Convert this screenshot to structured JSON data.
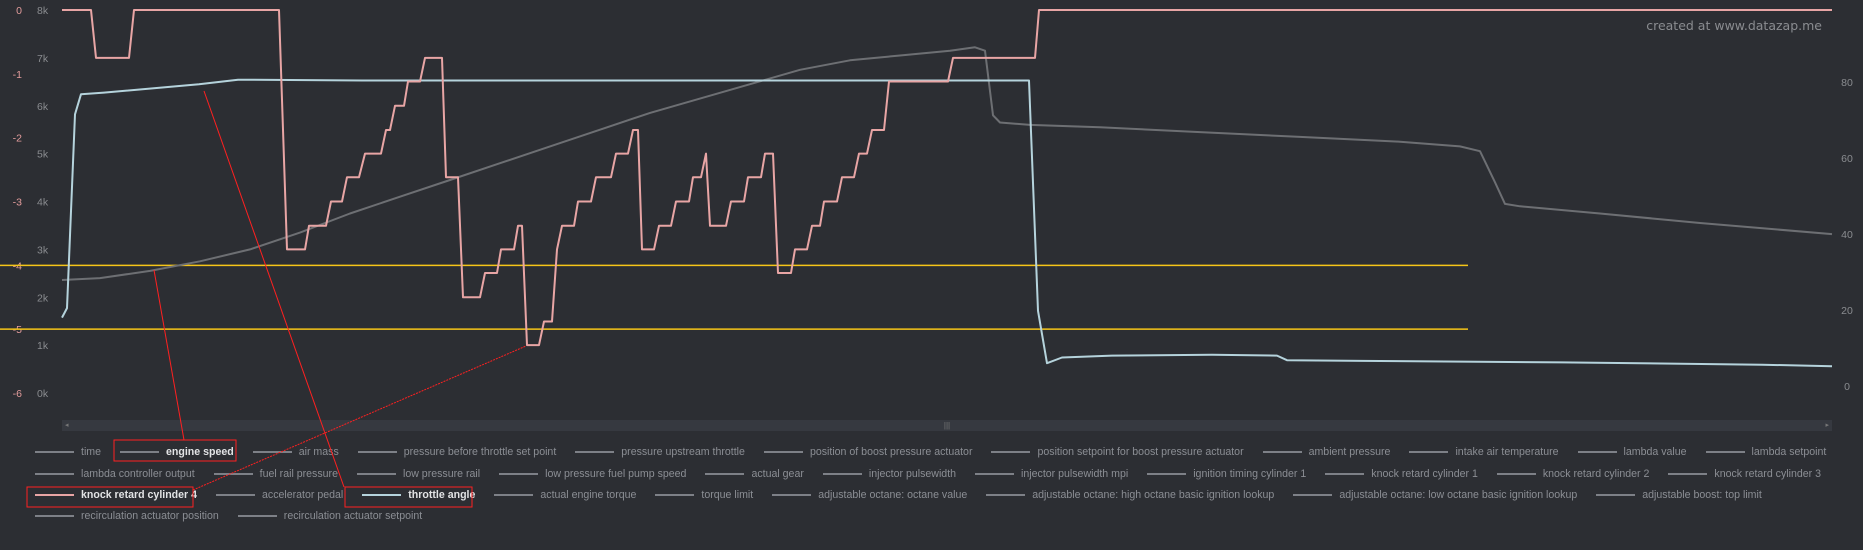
{
  "watermark": "created at www.datazap.me",
  "colors": {
    "background": "#2c2e33",
    "knock": "#e8a5a5",
    "throttle": "#b5d3dc",
    "engine_speed": "#6d6f73",
    "reference": "#f5c518",
    "annotation": "#ff2020",
    "knock_axis": "#e39c9c",
    "axis_text": "#8a8c90"
  },
  "chart_data": {
    "type": "line",
    "axes": {
      "knock": {
        "ticks": [
          "0",
          "-1",
          "-2",
          "-3",
          "-4",
          "-5",
          "-6"
        ],
        "range": [
          -6,
          0
        ]
      },
      "rpm": {
        "ticks": [
          "8k",
          "7k",
          "6k",
          "5k",
          "4k",
          "3k",
          "2k",
          "1k",
          "0k"
        ],
        "range": [
          0,
          8000
        ]
      },
      "right": {
        "ticks": [
          "80",
          "60",
          "40",
          "20",
          "0"
        ],
        "range": [
          -1.8,
          99
        ]
      },
      "x": {
        "range": [
          0,
          1770
        ],
        "labels": []
      }
    },
    "grid": false,
    "reference_lines": [
      {
        "axis": "knock",
        "value": -4
      },
      {
        "axis": "knock",
        "value": -5
      }
    ],
    "series": [
      {
        "name": "engine speed",
        "axis": "rpm",
        "color": "#6d6f73",
        "points": [
          [
            0,
            2360
          ],
          [
            38,
            2400
          ],
          [
            88,
            2550
          ],
          [
            138,
            2750
          ],
          [
            188,
            3000
          ],
          [
            238,
            3350
          ],
          [
            288,
            3750
          ],
          [
            338,
            4100
          ],
          [
            388,
            4450
          ],
          [
            438,
            4800
          ],
          [
            488,
            5150
          ],
          [
            538,
            5500
          ],
          [
            588,
            5850
          ],
          [
            638,
            6150
          ],
          [
            688,
            6450
          ],
          [
            738,
            6750
          ],
          [
            788,
            6950
          ],
          [
            838,
            7050
          ],
          [
            888,
            7150
          ],
          [
            913,
            7220
          ],
          [
            923,
            7150
          ],
          [
            931,
            5800
          ],
          [
            938,
            5650
          ],
          [
            968,
            5600
          ],
          [
            1038,
            5550
          ],
          [
            1138,
            5450
          ],
          [
            1238,
            5350
          ],
          [
            1338,
            5250
          ],
          [
            1398,
            5150
          ],
          [
            1418,
            5050
          ],
          [
            1433,
            4400
          ],
          [
            1443,
            3950
          ],
          [
            1458,
            3900
          ],
          [
            1538,
            3750
          ],
          [
            1638,
            3550
          ],
          [
            1770,
            3320
          ]
        ]
      },
      {
        "name": "throttle angle",
        "axis": "right",
        "color": "#b5d3dc",
        "points": [
          [
            0,
            18
          ],
          [
            5,
            20.5
          ],
          [
            13,
            71.5
          ],
          [
            19,
            76.8
          ],
          [
            42,
            77.2
          ],
          [
            137,
            79.4
          ],
          [
            176,
            80.6
          ],
          [
            300,
            80.4
          ],
          [
            600,
            80.4
          ],
          [
            967,
            80.4
          ],
          [
            976,
            19.8
          ],
          [
            985,
            6
          ],
          [
            1000,
            7.5
          ],
          [
            1050,
            8
          ],
          [
            1150,
            8.2
          ],
          [
            1215,
            8
          ],
          [
            1225,
            6.8
          ],
          [
            1300,
            6.6
          ],
          [
            1500,
            6.2
          ],
          [
            1700,
            5.6
          ],
          [
            1770,
            5.2
          ]
        ]
      },
      {
        "name": "knock retard cylinder 4",
        "axis": "knock",
        "color": "#e8a5a5",
        "points": [
          [
            0,
            0
          ],
          [
            29,
            0
          ],
          [
            34,
            -0.75
          ],
          [
            67,
            -0.75
          ],
          [
            72,
            0
          ],
          [
            217,
            0
          ],
          [
            225,
            -3.75
          ],
          [
            243,
            -3.75
          ],
          [
            247,
            -3.38
          ],
          [
            264,
            -3.38
          ],
          [
            269,
            -3
          ],
          [
            280,
            -3
          ],
          [
            285,
            -2.62
          ],
          [
            297,
            -2.62
          ],
          [
            303,
            -2.25
          ],
          [
            319,
            -2.25
          ],
          [
            324,
            -1.88
          ],
          [
            328,
            -1.88
          ],
          [
            333,
            -1.5
          ],
          [
            342,
            -1.5
          ],
          [
            346,
            -1.12
          ],
          [
            358,
            -1.12
          ],
          [
            363,
            -0.75
          ],
          [
            380,
            -0.75
          ],
          [
            384,
            -2.62
          ],
          [
            396,
            -2.62
          ],
          [
            401,
            -4.5
          ],
          [
            418,
            -4.5
          ],
          [
            423,
            -4.12
          ],
          [
            435,
            -4.12
          ],
          [
            439,
            -3.75
          ],
          [
            452,
            -3.75
          ],
          [
            456,
            -3.38
          ],
          [
            460,
            -3.38
          ],
          [
            465,
            -5.25
          ],
          [
            477,
            -5.25
          ],
          [
            482,
            -4.88
          ],
          [
            490,
            -4.88
          ],
          [
            495,
            -3.75
          ],
          [
            500,
            -3.38
          ],
          [
            512,
            -3.38
          ],
          [
            516,
            -3
          ],
          [
            529,
            -3
          ],
          [
            534,
            -2.62
          ],
          [
            549,
            -2.62
          ],
          [
            554,
            -2.25
          ],
          [
            566,
            -2.25
          ],
          [
            571,
            -1.88
          ],
          [
            576,
            -1.88
          ],
          [
            580,
            -3.75
          ],
          [
            592,
            -3.75
          ],
          [
            597,
            -3.38
          ],
          [
            609,
            -3.38
          ],
          [
            614,
            -3
          ],
          [
            627,
            -3
          ],
          [
            631,
            -2.62
          ],
          [
            639,
            -2.62
          ],
          [
            644,
            -2.25
          ],
          [
            648,
            -3.38
          ],
          [
            664,
            -3.38
          ],
          [
            669,
            -3
          ],
          [
            682,
            -3
          ],
          [
            686,
            -2.62
          ],
          [
            699,
            -2.62
          ],
          [
            703,
            -2.25
          ],
          [
            711,
            -2.25
          ],
          [
            716,
            -4.12
          ],
          [
            729,
            -4.12
          ],
          [
            733,
            -3.75
          ],
          [
            745,
            -3.75
          ],
          [
            750,
            -3.38
          ],
          [
            758,
            -3.38
          ],
          [
            762,
            -3
          ],
          [
            775,
            -3
          ],
          [
            780,
            -2.62
          ],
          [
            792,
            -2.62
          ],
          [
            797,
            -2.25
          ],
          [
            805,
            -2.25
          ],
          [
            810,
            -1.88
          ],
          [
            822,
            -1.88
          ],
          [
            827,
            -1.12
          ],
          [
            886,
            -1.12
          ],
          [
            891,
            -0.75
          ],
          [
            973,
            -0.75
          ],
          [
            977,
            0
          ],
          [
            1770,
            0
          ]
        ]
      }
    ]
  },
  "legend": {
    "rows": [
      [
        {
          "label": "time"
        },
        {
          "label": "engine speed",
          "highlighted": true
        },
        {
          "label": "air mass"
        },
        {
          "label": "pressure before throttle set point"
        },
        {
          "label": "pressure upstream throttle"
        },
        {
          "label": "position of boost pressure actuator"
        },
        {
          "label": "position setpoint for boost pressure actuator"
        },
        {
          "label": "ambient pressure"
        },
        {
          "label": "intake air temperature"
        },
        {
          "label": "lambda value"
        },
        {
          "label": "lambda setpoint"
        }
      ],
      [
        {
          "label": "lambda controller output"
        },
        {
          "label": "fuel rail pressure"
        },
        {
          "label": "low pressure rail"
        },
        {
          "label": "low pressure fuel pump speed"
        },
        {
          "label": "actual gear"
        },
        {
          "label": "injector pulsewidth"
        },
        {
          "label": "injector pulsewidth mpi"
        },
        {
          "label": "ignition timing cylinder 1"
        },
        {
          "label": "knock retard cylinder 1"
        },
        {
          "label": "knock retard cylinder 2"
        },
        {
          "label": "knock retard cylinder 3"
        }
      ],
      [
        {
          "label": "knock retard cylinder 4",
          "highlighted": true,
          "color": "#e8a5a5"
        },
        {
          "label": "accelerator pedal"
        },
        {
          "label": "throttle angle",
          "highlighted": true,
          "color": "#b5d3dc"
        },
        {
          "label": "actual engine torque"
        },
        {
          "label": "torque limit"
        },
        {
          "label": "adjustable octane: octane value"
        },
        {
          "label": "adjustable octane: high octane basic ignition lookup"
        },
        {
          "label": "adjustable octane: low octane basic ignition lookup"
        },
        {
          "label": "adjustable boost: top limit"
        }
      ],
      [
        {
          "label": "recirculation actuator position"
        },
        {
          "label": "recirculation actuator setpoint"
        }
      ]
    ]
  },
  "scrollbar": {
    "grip": "|||",
    "left_arrow": "◂",
    "right_arrow": "▸"
  }
}
